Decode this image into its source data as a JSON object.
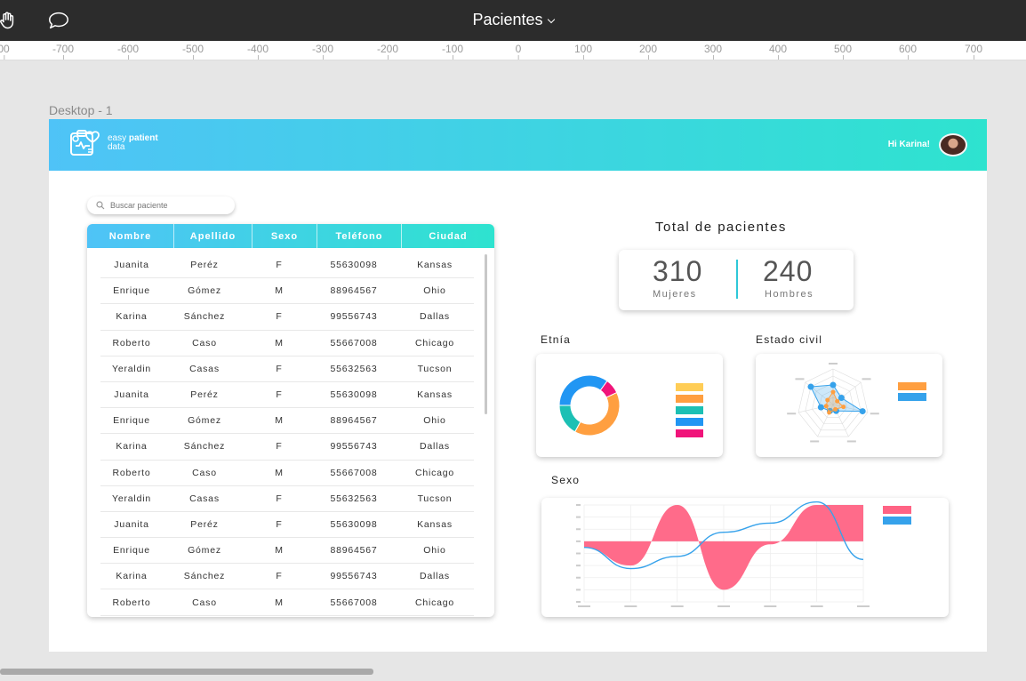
{
  "app": {
    "title": "Pacientes"
  },
  "ruler": [
    "00",
    "-700",
    "-600",
    "-500",
    "-400",
    "-300",
    "-200",
    "-100",
    "0",
    "100",
    "200",
    "300",
    "400",
    "500",
    "600",
    "700"
  ],
  "frame": {
    "label": "Desktop - 1"
  },
  "header": {
    "brand_line1_prefix": "easy ",
    "brand_line1_bold": "patient",
    "brand_line2": "data",
    "greeting": "Hi Karina!"
  },
  "search": {
    "placeholder": "Buscar paciente"
  },
  "table": {
    "columns": [
      "Nombre",
      "Apellido",
      "Sexo",
      "Teléfono",
      "Ciudad"
    ],
    "rows": [
      [
        "Juanita",
        "Peréz",
        "F",
        "55630098",
        "Kansas"
      ],
      [
        "Enrique",
        "Gómez",
        "M",
        "88964567",
        "Ohio"
      ],
      [
        "Karina",
        "Sánchez",
        "F",
        "99556743",
        "Dallas"
      ],
      [
        "Roberto",
        "Caso",
        "M",
        "55667008",
        "Chicago"
      ],
      [
        "Yeraldin",
        "Casas",
        "F",
        "55632563",
        "Tucson"
      ],
      [
        "Juanita",
        "Peréz",
        "F",
        "55630098",
        "Kansas"
      ],
      [
        "Enrique",
        "Gómez",
        "M",
        "88964567",
        "Ohio"
      ],
      [
        "Karina",
        "Sánchez",
        "F",
        "99556743",
        "Dallas"
      ],
      [
        "Roberto",
        "Caso",
        "M",
        "55667008",
        "Chicago"
      ],
      [
        "Yeraldin",
        "Casas",
        "F",
        "55632563",
        "Tucson"
      ],
      [
        "Juanita",
        "Peréz",
        "F",
        "55630098",
        "Kansas"
      ],
      [
        "Enrique",
        "Gómez",
        "M",
        "88964567",
        "Ohio"
      ],
      [
        "Karina",
        "Sánchez",
        "F",
        "99556743",
        "Dallas"
      ],
      [
        "Roberto",
        "Caso",
        "M",
        "55667008",
        "Chicago"
      ]
    ]
  },
  "totals": {
    "title": "Total de pacientes",
    "women_value": "310",
    "women_label": "Mujeres",
    "men_value": "240",
    "men_label": "Hombres"
  },
  "sections": {
    "etnia": "Etnía",
    "estado_civil": "Estado civil",
    "sexo": "Sexo"
  },
  "colors": {
    "accent_start": "#4fc3f7",
    "accent_end": "#2ee3cf",
    "pink": "#ff6384",
    "blue": "#36a2eb",
    "yellow": "#ffcd56",
    "orange": "#ff9f40",
    "teal": "#1cc0b4",
    "magenta": "#f0147a"
  },
  "chart_data": [
    {
      "type": "pie",
      "subtype": "donut",
      "values": [
        35,
        8,
        40,
        17
      ],
      "colors": [
        "#2196f3",
        "#f0147a",
        "#ff9f40",
        "#1cc0b4"
      ],
      "legend_colors": [
        "#ffcd56",
        "#ff9f40",
        "#1cc0b4",
        "#2196f3",
        "#f0147a"
      ],
      "legend_placement": "right"
    },
    {
      "type": "radar",
      "series": [
        {
          "values": [
            0.55,
            0.3,
            0.85,
            0.2,
            0.2,
            0.35,
            0.8
          ],
          "color": "#36a2eb"
        },
        {
          "values": [
            0.35,
            0.15,
            0.3,
            0.15,
            0.25,
            0.2,
            0.2
          ],
          "color": "#ff9f40"
        }
      ],
      "legend_colors": [
        "#ff9f40",
        "#36a2eb"
      ],
      "legend_placement": "right"
    },
    {
      "type": "line",
      "subtype": "filled-area-with-line",
      "x_count": 7,
      "series": [
        {
          "values": [
            -10,
            -40,
            60,
            -80,
            -5,
            60,
            60
          ],
          "color": "#ff6384",
          "fill": true
        },
        {
          "values": [
            -10,
            -45,
            -25,
            15,
            30,
            65,
            -30
          ],
          "color": "#36a2eb",
          "fill": false
        }
      ],
      "ylim": [
        -100,
        60
      ],
      "grid": true,
      "legend_colors": [
        "#ff6384",
        "#36a2eb"
      ],
      "legend_placement": "right"
    }
  ]
}
